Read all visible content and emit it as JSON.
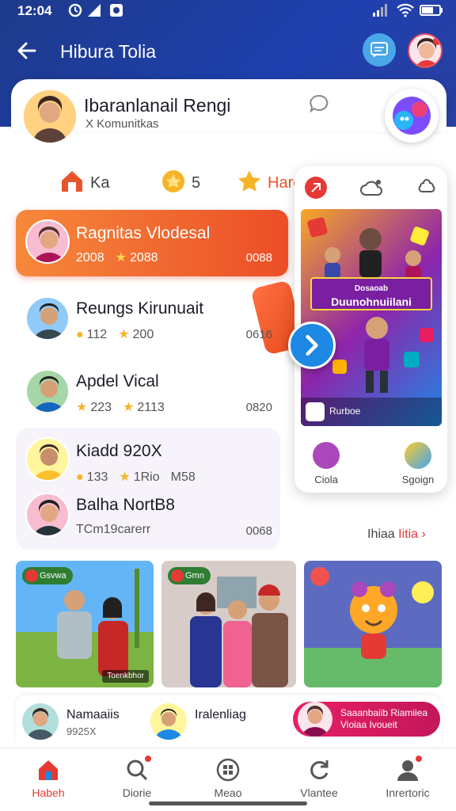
{
  "status_bar": {
    "time": "12:04"
  },
  "topbar": {
    "title": "Hibura Tolia"
  },
  "profile": {
    "name": "Ibaranlanail Rengi",
    "subtitle": "X Komunitkas"
  },
  "stats": [
    {
      "icon": "home-icon",
      "label": "Ka",
      "color": "#e8542b"
    },
    {
      "icon": "trophy-icon",
      "label": "5",
      "color": "#f5b428"
    },
    {
      "icon": "star-icon",
      "label": "Harc",
      "color": "#f5b428"
    }
  ],
  "list": [
    {
      "name": "Ragnitas Vlodesal",
      "meta1": "2008",
      "meta2": "2088",
      "count": "0088",
      "highlight": true
    },
    {
      "name": "Reungs Kirunuait",
      "meta1": "112",
      "meta2": "200",
      "count": "0616",
      "highlight": false
    },
    {
      "name": "Apdel Vical",
      "meta1": "223",
      "meta2": "2113",
      "count": "0820",
      "highlight": false
    },
    {
      "name": "Kiadd 920X",
      "meta1": "133",
      "meta2": "1Rio",
      "meta3": "M58",
      "count": "",
      "highlight": false
    },
    {
      "name": "Balha NortB8",
      "meta1": "TCm19carerr",
      "meta2": "",
      "count": "0068",
      "highlight": false
    }
  ],
  "side_panel": {
    "poster_title": "Duunohnuiilani",
    "poster_sub": "Dosaoab",
    "poster_footer": "Rurboe",
    "options": [
      {
        "label": "Ciola",
        "icon": "grape-icon"
      },
      {
        "label": "Sgoign",
        "icon": "smile-icon"
      }
    ]
  },
  "see_more": {
    "prefix": "Ihiaa ",
    "accent": "Iitia",
    "chevron": "›"
  },
  "photos": [
    {
      "tag": "Gsvwa",
      "caption": "Toenkbhor"
    },
    {
      "tag": "Gmn",
      "caption": ""
    },
    {
      "tag": "",
      "caption": ""
    }
  ],
  "bottom_users": [
    {
      "name": "Namaaiis",
      "meta": "9925X"
    },
    {
      "name": "Iralenliag",
      "meta": ""
    }
  ],
  "pill": {
    "line1": "Saaanbaiib Riamiiea",
    "line2": "Vioiaa Ivoueit"
  },
  "tabs": [
    {
      "label": "Habeh",
      "icon": "home-icon",
      "active": true
    },
    {
      "label": "Diorie",
      "icon": "search-icon",
      "active": false
    },
    {
      "label": "Meao",
      "icon": "grid-icon",
      "active": false
    },
    {
      "label": "Vlantee",
      "icon": "refresh-icon",
      "active": false
    },
    {
      "label": "Inrertoric",
      "icon": "profile-icon",
      "active": false
    }
  ],
  "colors": {
    "header": "#1e3a8a",
    "accent": "#e53935",
    "highlight_start": "#f6883b",
    "highlight_end": "#ec4e27",
    "star": "#f5b428"
  }
}
